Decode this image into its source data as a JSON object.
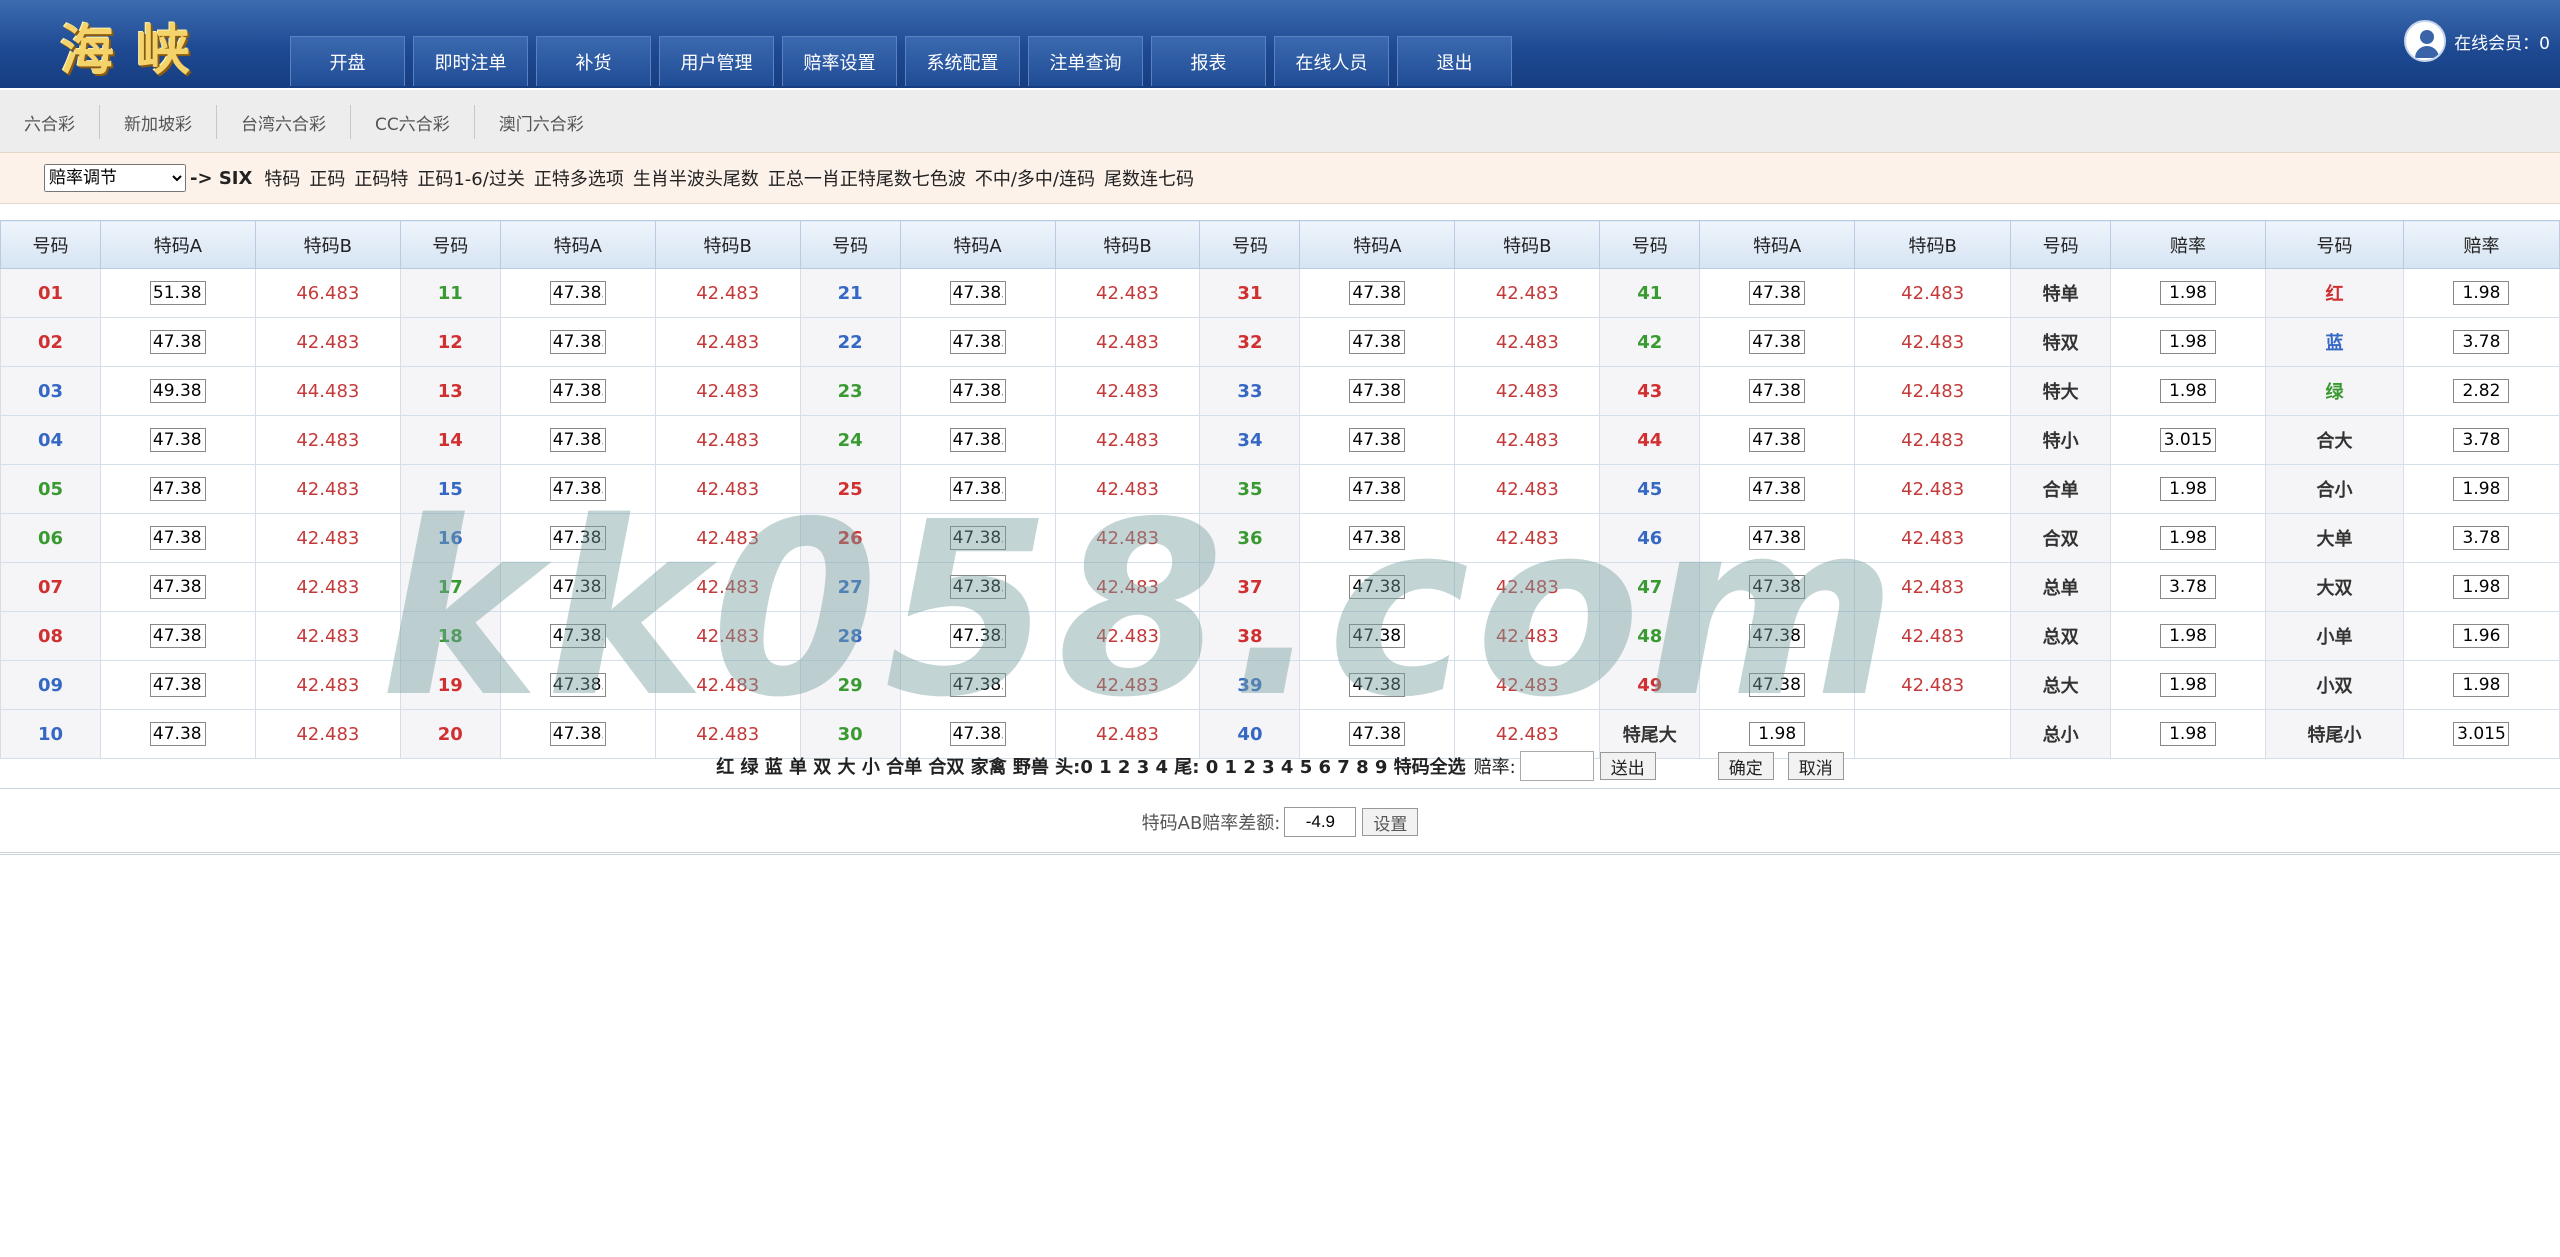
{
  "header": {
    "logo": "海峡",
    "nav": [
      "开盘",
      "即时注单",
      "补货",
      "用户管理",
      "赔率设置",
      "系统配置",
      "注单查询",
      "报表",
      "在线人员",
      "退出"
    ],
    "online": "在线会员：0"
  },
  "subnav": [
    "六合彩",
    "新加坡彩",
    "台湾六合彩",
    "CC六合彩",
    "澳门六合彩"
  ],
  "toolbar": {
    "select_value": "赔率调节",
    "arrow": "-> SIX",
    "links": [
      "特码",
      "正码",
      "正码特",
      "正码1-6/过关",
      "正特多选项",
      "生肖半波头尾数",
      "正总一肖正特尾数七色波",
      "不中/多中/连码",
      "尾数连七码"
    ]
  },
  "table": {
    "headers": [
      "号码",
      "特码A",
      "特码B",
      "号码",
      "特码A",
      "特码B",
      "号码",
      "特码A",
      "特码B",
      "号码",
      "特码A",
      "特码B",
      "号码",
      "特码A",
      "特码B",
      "号码",
      "赔率",
      "号码",
      "赔率"
    ],
    "rows": [
      [
        [
          "01",
          "r"
        ],
        "51.383",
        "46.483",
        [
          "11",
          "g"
        ],
        "47.383",
        "42.483",
        [
          "21",
          "b"
        ],
        "47.383",
        "42.483",
        [
          "31",
          "r"
        ],
        "47.383",
        "42.483",
        [
          "41",
          "g"
        ],
        "47.383",
        "42.483",
        "特单",
        "1.98",
        [
          "红",
          "r"
        ],
        "1.98"
      ],
      [
        [
          "02",
          "r"
        ],
        "47.383",
        "42.483",
        [
          "12",
          "r"
        ],
        "47.383",
        "42.483",
        [
          "22",
          "b"
        ],
        "47.383",
        "42.483",
        [
          "32",
          "r"
        ],
        "47.383",
        "42.483",
        [
          "42",
          "g"
        ],
        "47.383",
        "42.483",
        "特双",
        "1.98",
        [
          "蓝",
          "b"
        ],
        "3.78"
      ],
      [
        [
          "03",
          "b"
        ],
        "49.383",
        "44.483",
        [
          "13",
          "r"
        ],
        "47.383",
        "42.483",
        [
          "23",
          "g"
        ],
        "47.383",
        "42.483",
        [
          "33",
          "b"
        ],
        "47.383",
        "42.483",
        [
          "43",
          "r"
        ],
        "47.383",
        "42.483",
        "特大",
        "1.98",
        [
          "绿",
          "g"
        ],
        "2.82"
      ],
      [
        [
          "04",
          "b"
        ],
        "47.383",
        "42.483",
        [
          "14",
          "r"
        ],
        "47.383",
        "42.483",
        [
          "24",
          "g"
        ],
        "47.383",
        "42.483",
        [
          "34",
          "b"
        ],
        "47.383",
        "42.483",
        [
          "44",
          "r"
        ],
        "47.383",
        "42.483",
        "特小",
        "3.015",
        [
          "合大",
          ""
        ],
        "3.78"
      ],
      [
        [
          "05",
          "g"
        ],
        "47.383",
        "42.483",
        [
          "15",
          "b"
        ],
        "47.383",
        "42.483",
        [
          "25",
          "r"
        ],
        "47.383",
        "42.483",
        [
          "35",
          "g"
        ],
        "47.383",
        "42.483",
        [
          "45",
          "b"
        ],
        "47.383",
        "42.483",
        "合单",
        "1.98",
        [
          "合小",
          ""
        ],
        "1.98"
      ],
      [
        [
          "06",
          "g"
        ],
        "47.383",
        "42.483",
        [
          "16",
          "b"
        ],
        "47.383",
        "42.483",
        [
          "26",
          "r"
        ],
        "47.383",
        "42.483",
        [
          "36",
          "g"
        ],
        "47.383",
        "42.483",
        [
          "46",
          "b"
        ],
        "47.383",
        "42.483",
        "合双",
        "1.98",
        [
          "大单",
          ""
        ],
        "3.78"
      ],
      [
        [
          "07",
          "r"
        ],
        "47.383",
        "42.483",
        [
          "17",
          "g"
        ],
        "47.383",
        "42.483",
        [
          "27",
          "b"
        ],
        "47.383",
        "42.483",
        [
          "37",
          "r"
        ],
        "47.383",
        "42.483",
        [
          "47",
          "g"
        ],
        "47.383",
        "42.483",
        "总单",
        "3.78",
        [
          "大双",
          ""
        ],
        "1.98"
      ],
      [
        [
          "08",
          "r"
        ],
        "47.383",
        "42.483",
        [
          "18",
          "g"
        ],
        "47.383",
        "42.483",
        [
          "28",
          "b"
        ],
        "47.383",
        "42.483",
        [
          "38",
          "r"
        ],
        "47.383",
        "42.483",
        [
          "48",
          "g"
        ],
        "47.383",
        "42.483",
        "总双",
        "1.98",
        [
          "小单",
          ""
        ],
        "1.96"
      ],
      [
        [
          "09",
          "b"
        ],
        "47.383",
        "42.483",
        [
          "19",
          "r"
        ],
        "47.383",
        "42.483",
        [
          "29",
          "g"
        ],
        "47.383",
        "42.483",
        [
          "39",
          "b"
        ],
        "47.383",
        "42.483",
        [
          "49",
          "r"
        ],
        "47.383",
        "42.483",
        "总大",
        "1.98",
        [
          "小双",
          ""
        ],
        "1.98"
      ],
      [
        [
          "10",
          "b"
        ],
        "47.383",
        "42.483",
        [
          "20",
          "r"
        ],
        "47.383",
        "42.483",
        [
          "30",
          "g"
        ],
        "47.383",
        "42.483",
        [
          "40",
          "b"
        ],
        "47.383",
        "42.483",
        [
          "特尾大",
          ""
        ],
        "1.98",
        "",
        "总小",
        "1.98",
        [
          "特尾小",
          ""
        ],
        "3.015"
      ]
    ]
  },
  "quick": {
    "items": "红 绿 蓝 单 双 大 小 合单 合双 家禽 野兽 头:0 1 2 3 4 尾: 0 1 2 3 4 5 6 7 8 9 特码全选",
    "odds_label": "赔率:",
    "send_label": "送出",
    "ok_label": "确定",
    "cancel_label": "取消"
  },
  "diff": {
    "label": "特码AB赔率差额:",
    "value": "-4.9",
    "set_label": "设置"
  },
  "watermark": "kk058.com",
  "colors": {
    "red": "#d03030",
    "blue": "#3468c4",
    "green": "#3a9a32",
    "header": "#1e4a93"
  }
}
